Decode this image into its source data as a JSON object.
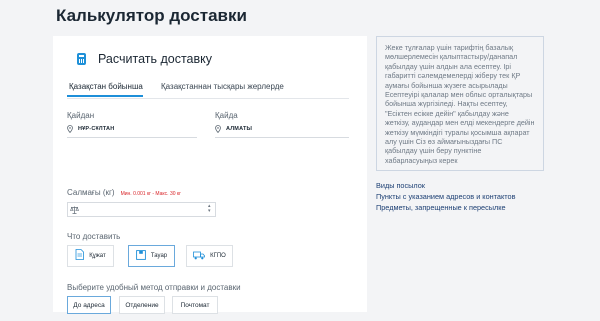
{
  "page": {
    "title": "Калькулятор доставки"
  },
  "card": {
    "title": "Расчитать доставку",
    "tabs": [
      "Қазақстан бойынша",
      "Қазақстаннан тысқары жерлерде"
    ],
    "from": {
      "label": "Қайдан",
      "value": "НҰР-СҰЛТАН"
    },
    "to": {
      "label": "Қайда",
      "value": "АЛМАТЫ"
    },
    "weight": {
      "label": "Салмағы (кг)",
      "hint": "Мин. 0.001 кг - Макс. 30 кг",
      "value": ""
    },
    "what": {
      "label": "Что доставить",
      "items": [
        {
          "label": "Құжат",
          "icon": "document-icon"
        },
        {
          "label": "Тауар",
          "icon": "box-icon"
        },
        {
          "label": "КГПО",
          "icon": "truck-icon"
        }
      ]
    },
    "method": {
      "label": "Выберите удобный метод отправки и доставки",
      "options": [
        "До адреса",
        "Отделение",
        "Почтомат"
      ]
    }
  },
  "info": {
    "text": "Жеке тұлғалар үшін тарифтің базалық мөлшерлемесін қалыптастыру/данапал қабылдау үшін алдын ала есептеу. Ірі габаритті сәлемдемелерді жіберу тек ҚР аумағы бойынша жүзеге асырылады Есептеуірі қалалар мен облыс орталықтары бойынша жүргізіледі. Нақты есептеу, \"Есіктен есікке дейін\" қабылдау және жеткізу, аудандар мен елді мекендерге дейін жеткізу мүмкіндігі туралы қосымша ақпарат алу үшін Сіз өз аймағыныздағы ПС қабылдау үшін беру пунктіне хабарласуыңыз керек"
  },
  "links": [
    "Виды посылок",
    "Пункты с указанием адресов и контактов",
    "Предметы, запрещенные к пересылке"
  ],
  "colors": {
    "accent": "#1e8fd9",
    "error": "#d9262a",
    "link": "#1c3f73"
  }
}
